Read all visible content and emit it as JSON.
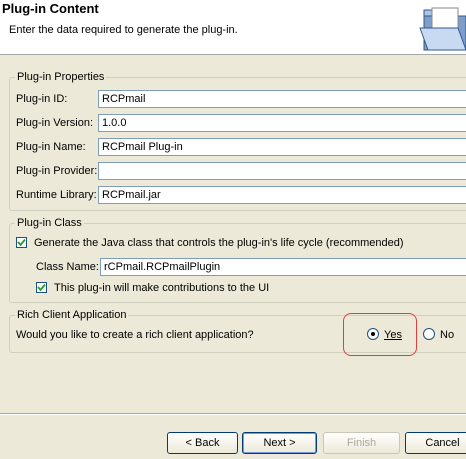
{
  "header": {
    "title": "Plug-in Content",
    "description": "Enter the data required to generate the plug-in.",
    "icon": "folder-icon"
  },
  "properties": {
    "group_title": "Plug-in Properties",
    "id_label": "Plug-in ID:",
    "id_value": "RCPmail",
    "version_label": "Plug-in Version:",
    "version_value": "1.0.0",
    "name_label": "Plug-in Name:",
    "name_value": "RCPmail Plug-in",
    "provider_label": "Plug-in Provider:",
    "provider_value": "",
    "library_label": "Runtime Library:",
    "library_value": "RCPmail.jar"
  },
  "plugin_class": {
    "group_title": "Plug-in Class",
    "generate_label": "Generate the Java class that controls the plug-in's life cycle (recommended)",
    "generate_checked": true,
    "classname_label": "Class Name:",
    "classname_value": "rCPmail.RCPmailPlugin",
    "contributes_label": "This plug-in will make contributions to the UI",
    "contributes_checked": true
  },
  "rich_client": {
    "group_title": "Rich Client Application",
    "question": "Would you like to create a rich client application?",
    "yes_label": "Yes",
    "no_label": "No",
    "selected": "Yes"
  },
  "buttons": {
    "back": "< Back",
    "next": "Next >",
    "finish": "Finish",
    "cancel": "Cancel"
  },
  "colors": {
    "highlight": "#e0403c",
    "dialog_bg": "#ece9d8"
  }
}
